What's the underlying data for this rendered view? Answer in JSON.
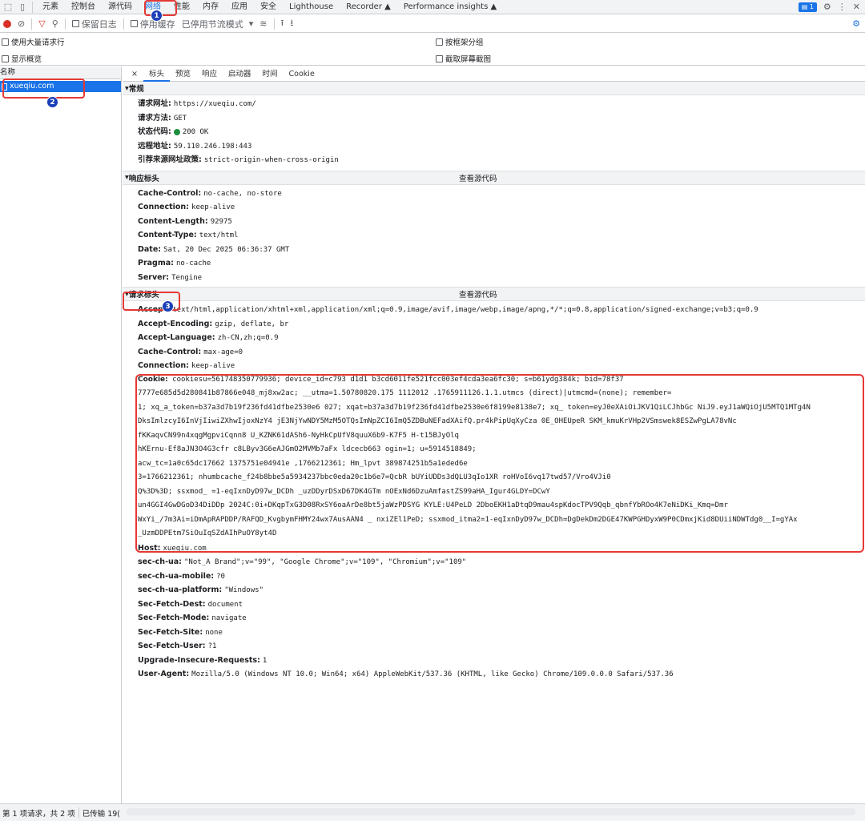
{
  "tabs": [
    "元素",
    "控制台",
    "源代码",
    "网络",
    "性能",
    "内存",
    "应用",
    "安全",
    "Lighthouse",
    "Recorder",
    "Performance insights"
  ],
  "issues_count": "1",
  "toolbar": {
    "preserve_log": "保留日志",
    "disable_cache": "停用缓存",
    "throttle": "已停用节流模式"
  },
  "options": {
    "large_rows": "使用大量请求行",
    "overview": "显示概览",
    "group_by_frame": "按框架分组",
    "screenshots": "截取屏幕截图"
  },
  "left": {
    "name_header": "名称",
    "request": "xueqiu.com"
  },
  "detail_tabs": [
    "×",
    "标头",
    "预览",
    "响应",
    "启动器",
    "时间",
    "Cookie"
  ],
  "general": {
    "title": "常规",
    "rows": [
      {
        "k": "请求网址:",
        "v": "https://xueqiu.com/"
      },
      {
        "k": "请求方法:",
        "v": "GET"
      },
      {
        "k": "状态代码:",
        "v": "200 OK"
      },
      {
        "k": "远程地址:",
        "v": "59.110.246.198:443"
      },
      {
        "k": "引荐来源网址政策:",
        "v": "strict-origin-when-cross-origin"
      }
    ]
  },
  "response_headers": {
    "title": "响应标头",
    "view_source": "查看源代码",
    "rows": [
      {
        "k": "Cache-Control:",
        "v": "no-cache, no-store"
      },
      {
        "k": "Connection:",
        "v": "keep-alive"
      },
      {
        "k": "Content-Length:",
        "v": "92975"
      },
      {
        "k": "Content-Type:",
        "v": "text/html"
      },
      {
        "k": "Date:",
        "v": "Sat, 20 Dec 2025 06:36:37 GMT"
      },
      {
        "k": "Pragma:",
        "v": "no-cache"
      },
      {
        "k": "Server:",
        "v": "Tengine"
      }
    ]
  },
  "request_headers": {
    "title": "请求标头",
    "view_source": "查看源代码",
    "rows_before": [
      {
        "k": "Accept:",
        "v": "text/html,application/xhtml+xml,application/xml;q=0.9,image/avif,image/webp,image/apng,*/*;q=0.8,application/signed-exchange;v=b3;q=0.9"
      },
      {
        "k": "Accept-Encoding:",
        "v": "gzip, deflate, br"
      },
      {
        "k": "Accept-Language:",
        "v": "zh-CN,zh;q=0.9"
      },
      {
        "k": "Cache-Control:",
        "v": "max-age=0"
      },
      {
        "k": "Connection:",
        "v": "keep-alive"
      }
    ],
    "cookie_key": "Cookie:",
    "cookie_lines": [
      "cookiesu=561748350779936; device_id=c793                            d1d1                 b3cd6011fe521fcc003ef4cda3ea6fc30; s=b61ydg384k; bid=78f37",
      "7777e685d5d280841b87866e048_mj8xw2ac; __utma=1.50780820.175        1112012                  .1765911126.1.1.utmcs                (direct)|utmcmd=(none); remember=",
      "1; xq_a_token=b37a3d7b19f236fd41dfbe2530e6              027; xqat=b37a3d7b19f236fd41dfbe2530e6f8199e8138e7; xq_     token=eyJ0eXAiOiJKV1QiLCJhbGc           NiJ9.eyJ1aWQiOjU5MTQ1MTg4N",
      "DksImlzcyI6InVjIiwiZXhwIjoxNzY4                    jE3NjYwNDY5MzM5OTQsImNpZCI6ImQ5ZDBuNEFadXAifQ.pr4kPipUqXyCza       0E_OHEUpeR          SKM_kmuKrVHp2VSmswek8ESZwPgLA78vNc",
      "fKKaqvCN99n4xqgMgpviCqnn8                  U_KZNK61dASh6-NyHkCpUfV8quuX6b9-K7F5                                                         H-t15BJyOlq",
      "hKErnu-Ef8aJN3O4G3cfr   c8LByv3G6eAJGmO2MVMb7aFx                                                        ldcecb663        ogin=1; u=5914518849;",
      "acw_tc=1a0c65dc17662     1375751e04941e                                                               ,1766212361; Hm_lpvt     389874251b5a1eded6e",
      "3=1766212361;               nhumbcache_f24b8bbe5a5934237bbc0eda20c1b6e7=QcbR                   bUYiUDDs3dQLU3qIo1XR         roHVoI6vq17twd57/Vro4VJi0",
      "Q%3D%3D; ssxmod_     =1-eqIxnDyD97w_DCDh                                    _uzDDyrDSxD67DK4GTm          nOExNd6DzuAmfastZS99aHA_Igur4GLDY=DCwY",
      "un4GGI4GwDGoD34DiDDp                       2024C:0i+DKqpTxG3D08RxSY6oaArDe8bt5jaWzPDSYG  KYLE:U4PeLD   2DboEKH1aDtqD9mau4spKdocTPV9Qqb_qbnfYbROo4K7eNiDKi_Kmq=Dmr",
      "WxYi_/7m3Ai=iDmApRAPDDP/RAFQD_KvgbymFHMY24wx7AusAAN4    _       nxiZEl1PeD; ssxmod_itma2=1-eqIxnDyD97w_DCDh=DgDekDm2DGE47KWPGHDyxW9P0CDmxjKid8DUiiNDWTdg0__I=gYAx",
      "_UzmDDPEtm7SiOuIqSZdAIhPuOY8yt4D"
    ],
    "rows_after": [
      {
        "k": "Host:",
        "v": "xueqiu.com"
      },
      {
        "k": "sec-ch-ua:",
        "v": "\"Not_A Brand\";v=\"99\", \"Google Chrome\";v=\"109\", \"Chromium\";v=\"109\""
      },
      {
        "k": "sec-ch-ua-mobile:",
        "v": "?0"
      },
      {
        "k": "sec-ch-ua-platform:",
        "v": "\"Windows\""
      },
      {
        "k": "Sec-Fetch-Dest:",
        "v": "document"
      },
      {
        "k": "Sec-Fetch-Mode:",
        "v": "navigate"
      },
      {
        "k": "Sec-Fetch-Site:",
        "v": "none"
      },
      {
        "k": "Sec-Fetch-User:",
        "v": "?1"
      },
      {
        "k": "Upgrade-Insecure-Requests:",
        "v": "1"
      },
      {
        "k": "User-Agent:",
        "v": "Mozilla/5.0 (Windows NT 10.0; Win64; x64) AppleWebKit/537.36 (KHTML, like Gecko) Chrome/109.0.0.0 Safari/537.36"
      }
    ]
  },
  "status_bar": {
    "requests": "第 1 项请求，共 2 项",
    "transferred": "已传输 19("
  },
  "badges": [
    "1",
    "2",
    "3"
  ],
  "colors": {
    "accent": "#1a73e8",
    "highlight": "#e53935",
    "status_ok": "#1e8e3e"
  }
}
